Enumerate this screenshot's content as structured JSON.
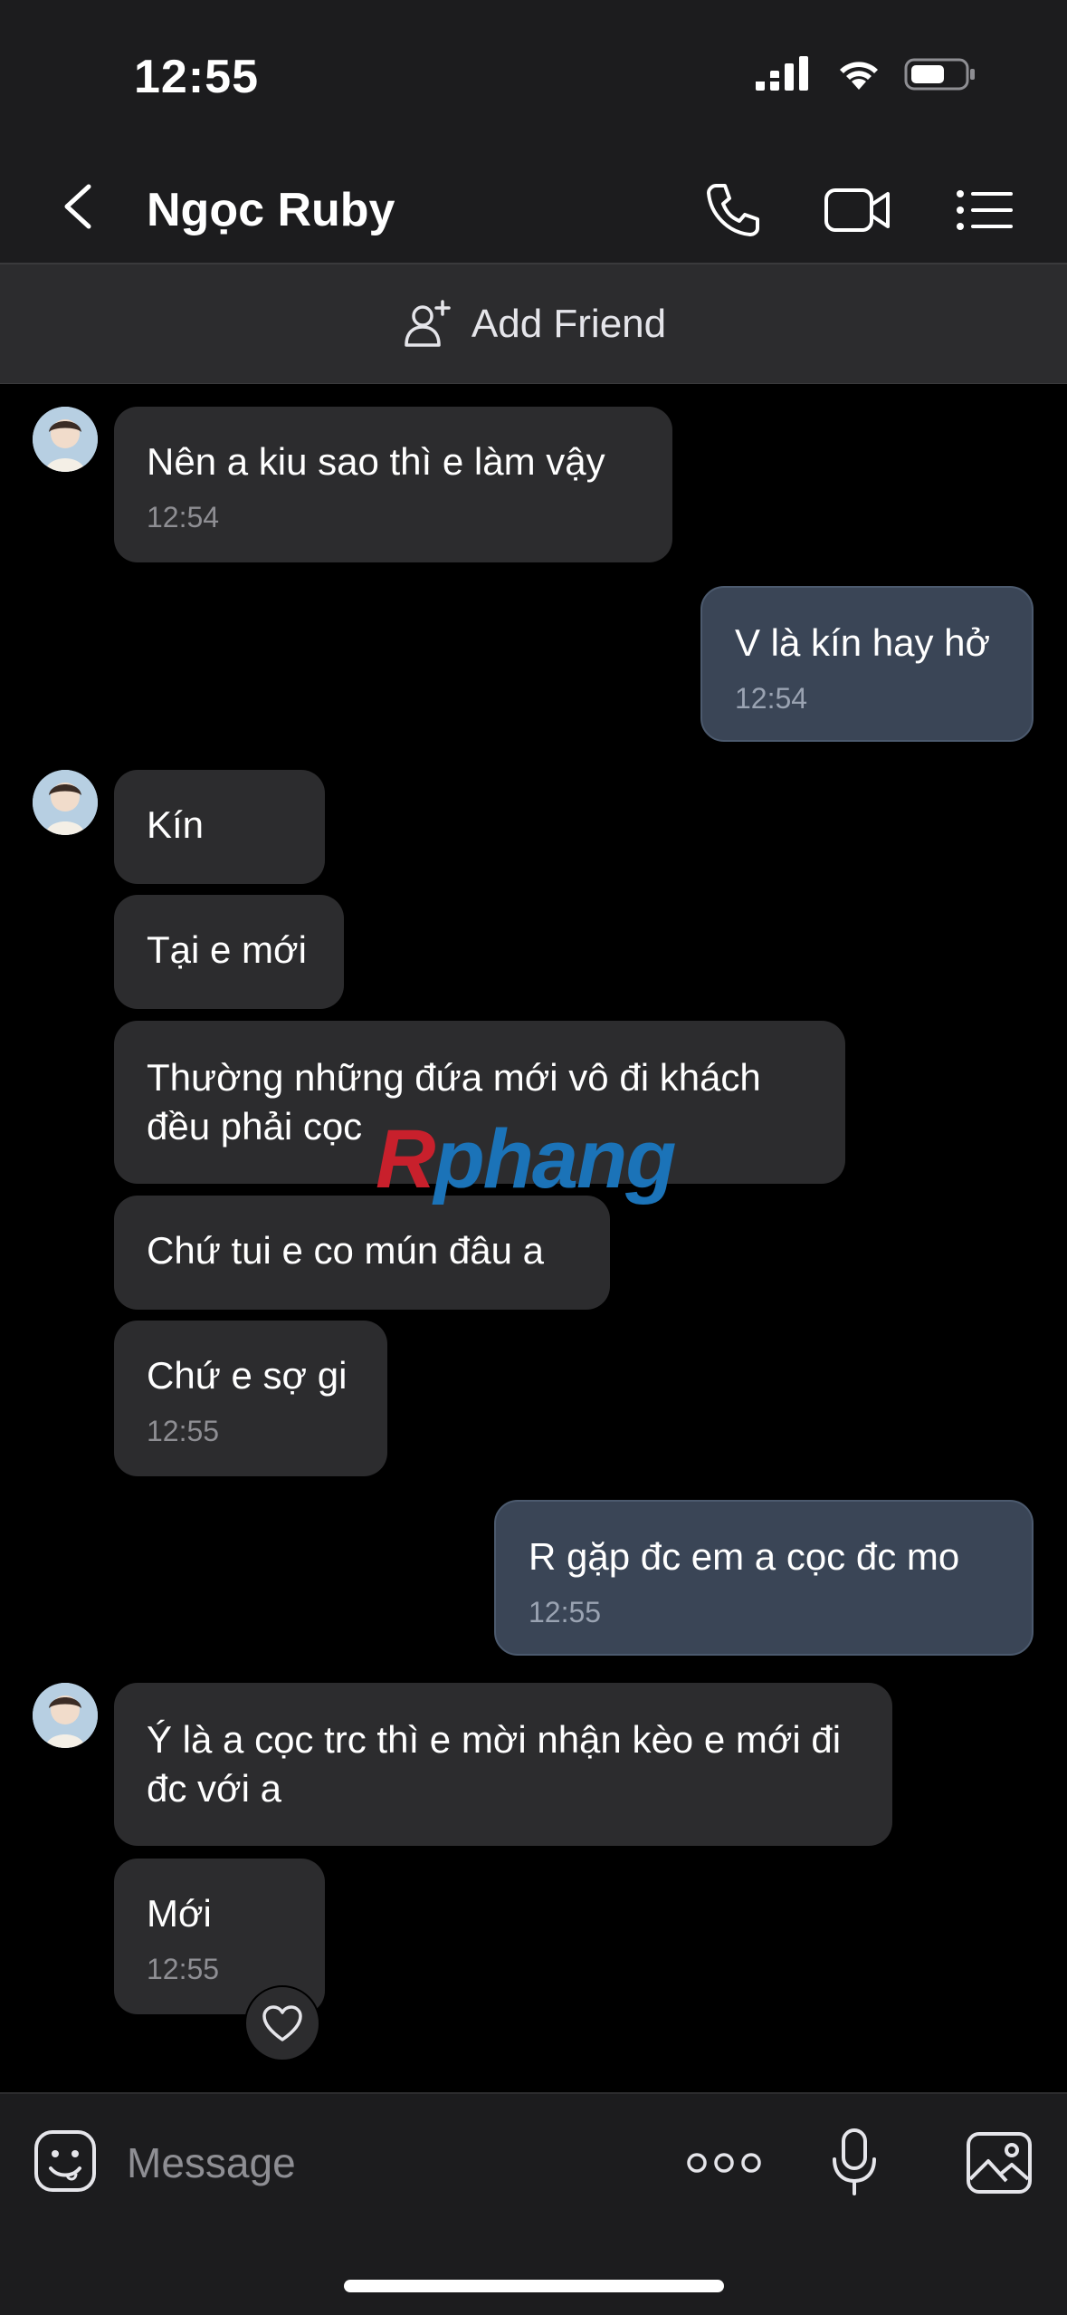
{
  "status_bar": {
    "time": "12:55"
  },
  "header": {
    "contact_name": "Ngọc Ruby"
  },
  "add_friend": {
    "label": "Add Friend"
  },
  "messages": [
    {
      "text": "Nên a kiu sao thì e làm vậy",
      "time": "12:54"
    },
    {
      "text": "V là kín hay hở",
      "time": "12:54"
    },
    {
      "text": "Kín"
    },
    {
      "text": "Tại e mới"
    },
    {
      "text": "Thường những đứa mới vô đi khách đều phải cọc"
    },
    {
      "text": "Chứ tui e co mún đâu a"
    },
    {
      "text": "Chứ e sợ gi",
      "time": "12:55"
    },
    {
      "text": "R gặp đc em a cọc đc mo",
      "time": "12:55"
    },
    {
      "text": "Ý là a cọc trc thì e mời nhận kèo e mới đi đc với a"
    },
    {
      "text": "Mới",
      "time": "12:55"
    }
  ],
  "watermark": {
    "part1": "R",
    "part2": "phang"
  },
  "composer": {
    "placeholder": "Message"
  },
  "colors": {
    "incoming_bubble": "#2c2c2e",
    "outgoing_bubble": "#3a4556",
    "bar_background": "#1c1c1e"
  },
  "icons": [
    "back-icon",
    "phone-icon",
    "video-icon",
    "menu-icon",
    "add-friend-icon",
    "emoji-icon",
    "more-icon",
    "mic-icon",
    "image-icon",
    "heart-icon"
  ]
}
